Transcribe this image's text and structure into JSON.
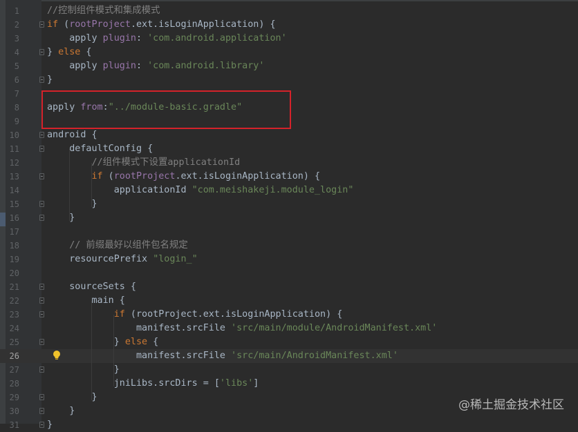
{
  "watermark": "@稀土掘金技术社区",
  "current_line": 26,
  "lines": [
    {
      "n": "1",
      "t": [
        [
          "cmt",
          "//控制组件模式和集成模式"
        ]
      ]
    },
    {
      "n": "2",
      "t": [
        [
          "kw",
          "if"
        ],
        [
          "plain",
          " ("
        ],
        [
          "prop",
          "rootProject"
        ],
        [
          "plain",
          ".ext.isLoginApplication) {"
        ]
      ]
    },
    {
      "n": "3",
      "t": [
        [
          "plain",
          "    apply "
        ],
        [
          "prop",
          "plugin"
        ],
        [
          "plain",
          ": "
        ],
        [
          "str",
          "'com.android.application'"
        ]
      ]
    },
    {
      "n": "4",
      "t": [
        [
          "plain",
          "} "
        ],
        [
          "kw",
          "else"
        ],
        [
          "plain",
          " {"
        ]
      ]
    },
    {
      "n": "5",
      "t": [
        [
          "plain",
          "    apply "
        ],
        [
          "prop",
          "plugin"
        ],
        [
          "plain",
          ": "
        ],
        [
          "str",
          "'com.android.library'"
        ]
      ]
    },
    {
      "n": "6",
      "t": [
        [
          "plain",
          "}"
        ]
      ]
    },
    {
      "n": "7",
      "t": []
    },
    {
      "n": "8",
      "t": [
        [
          "plain",
          "apply "
        ],
        [
          "prop",
          "from"
        ],
        [
          "plain",
          ":"
        ],
        [
          "str",
          "\"../module-basic.gradle\""
        ]
      ]
    },
    {
      "n": "9",
      "t": []
    },
    {
      "n": "10",
      "t": [
        [
          "plain",
          "android {"
        ]
      ]
    },
    {
      "n": "11",
      "t": [
        [
          "plain",
          "    defaultConfig {"
        ]
      ]
    },
    {
      "n": "12",
      "t": [
        [
          "cmt",
          "        //组件模式下设置applicationId"
        ]
      ]
    },
    {
      "n": "13",
      "t": [
        [
          "kw",
          "        if"
        ],
        [
          "plain",
          " ("
        ],
        [
          "prop",
          "rootProject"
        ],
        [
          "plain",
          ".ext.isLoginApplication) {"
        ]
      ]
    },
    {
      "n": "14",
      "t": [
        [
          "plain",
          "            applicationId "
        ],
        [
          "str",
          "\"com.meishakeji.module_login\""
        ]
      ]
    },
    {
      "n": "15",
      "t": [
        [
          "plain",
          "        }"
        ]
      ]
    },
    {
      "n": "16",
      "t": [
        [
          "plain",
          "    }"
        ]
      ]
    },
    {
      "n": "17",
      "t": []
    },
    {
      "n": "18",
      "t": [
        [
          "cmt",
          "    // 前缀最好以组件包名规定"
        ]
      ]
    },
    {
      "n": "19",
      "t": [
        [
          "plain",
          "    resourcePrefix "
        ],
        [
          "str",
          "\"login_\""
        ]
      ]
    },
    {
      "n": "20",
      "t": []
    },
    {
      "n": "21",
      "t": [
        [
          "plain",
          "    sourceSets {"
        ]
      ]
    },
    {
      "n": "22",
      "t": [
        [
          "plain",
          "        main {"
        ]
      ]
    },
    {
      "n": "23",
      "t": [
        [
          "kw",
          "            if"
        ],
        [
          "plain",
          " (rootProject.ext.isLoginApplication) {"
        ]
      ]
    },
    {
      "n": "24",
      "t": [
        [
          "plain",
          "                manifest.srcFile "
        ],
        [
          "str",
          "'src/main/module/AndroidManifest.xml'"
        ]
      ]
    },
    {
      "n": "25",
      "t": [
        [
          "plain",
          "            } "
        ],
        [
          "kw",
          "else"
        ],
        [
          "plain",
          " {"
        ]
      ]
    },
    {
      "n": "26",
      "t": [
        [
          "plain",
          "                manifest.srcFile "
        ],
        [
          "str",
          "'src/main/AndroidManifest.xml'"
        ]
      ]
    },
    {
      "n": "27",
      "t": [
        [
          "plain",
          "            }"
        ]
      ]
    },
    {
      "n": "28",
      "t": [
        [
          "plain",
          "            jniLibs.srcDirs = ["
        ],
        [
          "str",
          "'libs'"
        ],
        [
          "plain",
          "]"
        ]
      ]
    },
    {
      "n": "29",
      "t": [
        [
          "plain",
          "        }"
        ]
      ]
    },
    {
      "n": "30",
      "t": [
        [
          "plain",
          "    }"
        ]
      ]
    },
    {
      "n": "31",
      "t": [
        [
          "plain",
          "}"
        ]
      ]
    }
  ]
}
